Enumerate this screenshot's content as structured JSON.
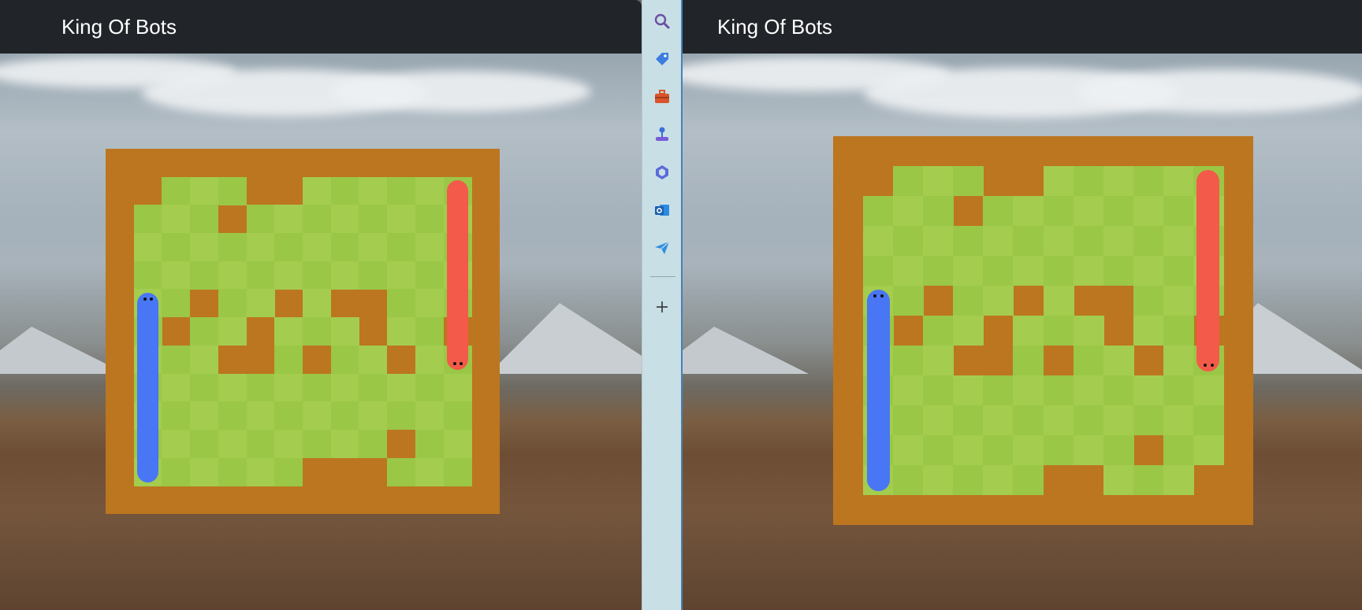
{
  "app": {
    "title": "King Of Bots"
  },
  "windows": [
    {
      "id": "left",
      "navbar": {
        "brand": "King Of Bots"
      },
      "board": {
        "rows": 13,
        "cols": 14,
        "walls": [
          "##############",
          "##...##......#",
          "#...#........#",
          "#............#",
          "#............#",
          "#..#..#.##...#",
          "#.#..#...#..##",
          "#...##.#..#..#",
          "#............#",
          "#............#",
          "#.........#..#",
          "#......###...#",
          "##############"
        ],
        "snakes": [
          {
            "color": "#4876f5",
            "col": 1,
            "rowStart": 5,
            "rowEnd": 11,
            "headAtTop": true
          },
          {
            "color": "#f35a49",
            "col": 12,
            "rowStart": 1,
            "rowEnd": 7,
            "headAtTop": false
          }
        ]
      }
    },
    {
      "id": "right",
      "navbar": {
        "brand": "King Of Bots"
      },
      "board": {
        "rows": 13,
        "cols": 14,
        "walls": [
          "##############",
          "##...##......#",
          "#...#........#",
          "#............#",
          "#............#",
          "#..#..#.##...#",
          "#.#..#...#..##",
          "#...##.#..#..#",
          "#............#",
          "#............#",
          "#.........#..#",
          "#......##...##",
          "##############"
        ],
        "snakes": [
          {
            "color": "#4876f5",
            "col": 1,
            "rowStart": 5,
            "rowEnd": 11,
            "headAtTop": true
          },
          {
            "color": "#f35a49",
            "col": 12,
            "rowStart": 1,
            "rowEnd": 7,
            "headAtTop": false
          }
        ]
      }
    }
  ],
  "sidebar": {
    "icons": [
      {
        "name": "search-icon",
        "color": "#6b4fa3"
      },
      {
        "name": "tag-icon",
        "color": "#3b7de0"
      },
      {
        "name": "toolbox-icon",
        "color": "#d9542b"
      },
      {
        "name": "joystick-icon",
        "color": "#3a6fd8"
      },
      {
        "name": "copilot-icon",
        "color": "#5b6bd8"
      },
      {
        "name": "outlook-icon",
        "color": "#1e6fc5"
      },
      {
        "name": "send-icon",
        "color": "#2f8fe0"
      },
      {
        "name": "add-icon",
        "color": "#333333"
      }
    ]
  },
  "colors": {
    "wall": "#bc7620",
    "grass_light": "#a4cc4e",
    "grass_dark": "#9ac746",
    "navbar": "#212529"
  }
}
